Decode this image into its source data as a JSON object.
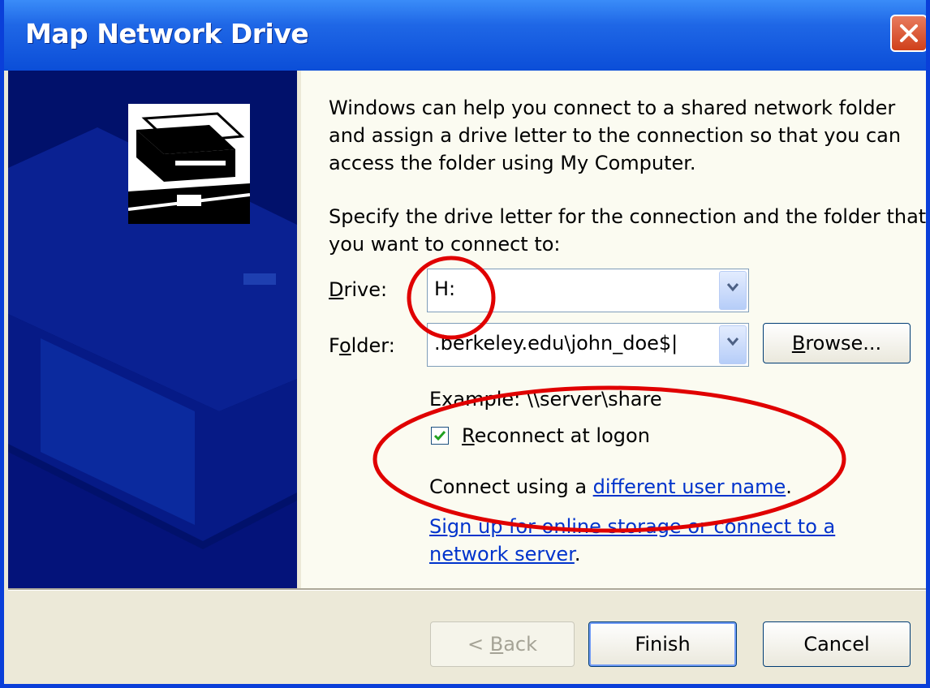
{
  "window": {
    "title": "Map Network Drive"
  },
  "intro": {
    "text": "Windows can help you connect to a shared network folder and assign a drive letter to the connection so that you can access the folder using My Computer."
  },
  "instruction": {
    "text": "Specify the drive letter for the connection and the folder that you want to connect to:"
  },
  "drive": {
    "label_u": "D",
    "label_rest": "rive:",
    "value": "H:"
  },
  "folder": {
    "label_pre": "F",
    "label_u": "o",
    "label_rest": "lder:",
    "value": ".berkeley.edu\\john_doe$|"
  },
  "browse": {
    "u": "B",
    "rest": "rowse..."
  },
  "example": {
    "text": "Example: \\\\server\\share"
  },
  "reconnect": {
    "u": "R",
    "rest": "econnect at logon",
    "checked": true
  },
  "connect_using": {
    "prefix": "Connect using a ",
    "link": "different user name",
    "suffix": "."
  },
  "signup": {
    "link": "Sign up for online storage or connect to a network server",
    "suffix": "."
  },
  "buttons": {
    "back_pre": "< ",
    "back_u": "B",
    "back_rest": "ack",
    "finish": "Finish",
    "cancel": "Cancel"
  },
  "colors": {
    "titlebar": "#0b4ed8",
    "sidebar": "#01116b",
    "annotation": "#e00000",
    "dialog_bg": "#ece9d8"
  }
}
